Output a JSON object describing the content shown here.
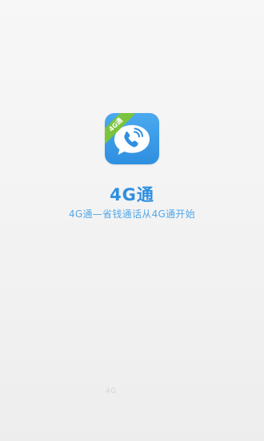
{
  "app": {
    "name": "4G通",
    "slogan": "4G通—省钱通话从4G通开始",
    "icon_badge": "4G通",
    "icon": "speech-bubble-phone-icon"
  },
  "footer": {
    "faint_text": "4G"
  },
  "colors": {
    "brand_blue": "#2f8fe0",
    "badge_green": "#7cc43d",
    "background": "#f4f4f4"
  }
}
